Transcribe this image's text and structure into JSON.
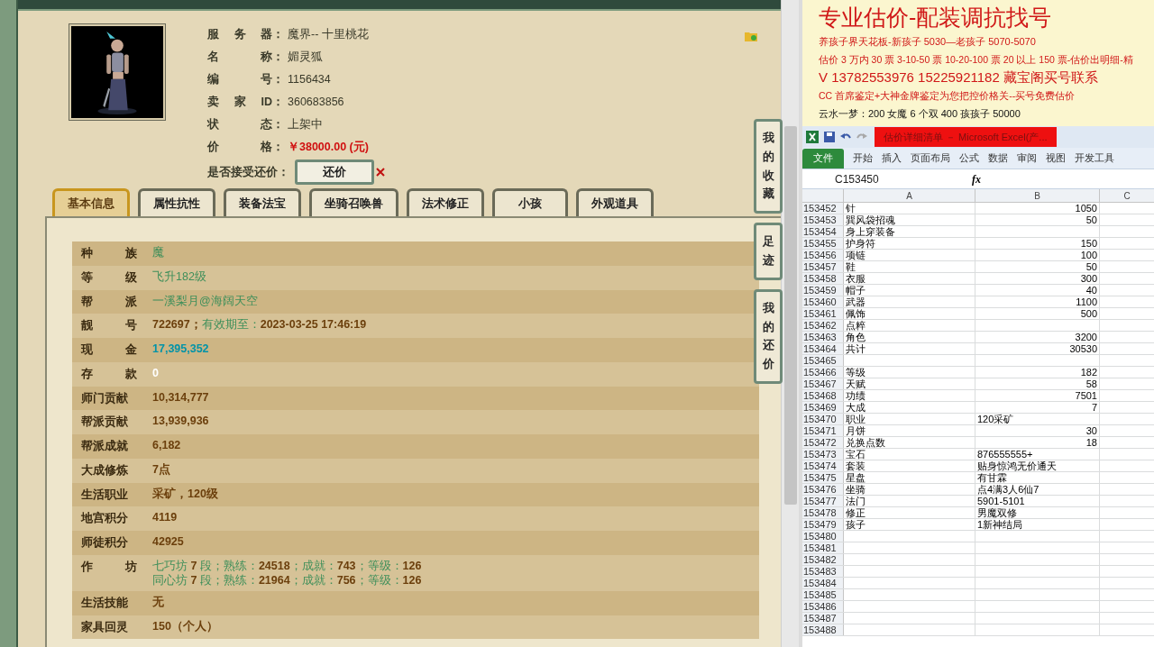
{
  "profile": {
    "info": [
      {
        "label": "服务器",
        "colon": "：",
        "value": "魔界-- 十里桃花",
        "kind": "plain"
      },
      {
        "label": "名称",
        "colon": "：",
        "value": "媚灵狐",
        "kind": "plain"
      },
      {
        "label": "编号",
        "colon": "：",
        "value": "1156434",
        "kind": "plain"
      },
      {
        "label": "卖家ID",
        "colon": "：",
        "value": "360683856",
        "kind": "plain"
      },
      {
        "label": "状态",
        "colon": "：",
        "value": "上架中",
        "kind": "plain"
      },
      {
        "label": "价格",
        "colon": "：",
        "value": "￥38000.00 (元)",
        "kind": "price"
      }
    ],
    "offer_label": "是否接受还价：",
    "offer_button": "还价"
  },
  "tabs": [
    {
      "label": "基本信息",
      "selected": true
    },
    {
      "label": "属性抗性",
      "selected": false
    },
    {
      "label": "装备法宝",
      "selected": false
    },
    {
      "label": "坐骑召唤兽",
      "selected": false
    },
    {
      "label": "法术修正",
      "selected": false
    },
    {
      "label": "小孩",
      "selected": false
    },
    {
      "label": "外观道具",
      "selected": false
    }
  ],
  "side_buttons": [
    "我的收藏",
    "足迹",
    "我的还价"
  ],
  "details": [
    {
      "label": "种族",
      "lines": [
        [
          {
            "text": "魔",
            "kind": "green"
          }
        ]
      ]
    },
    {
      "label": "等级",
      "lines": [
        [
          {
            "text": "飞升182级",
            "kind": "green"
          }
        ]
      ]
    },
    {
      "label": "帮派",
      "lines": [
        [
          {
            "text": "一溪梨月@海阔天空",
            "kind": "green"
          }
        ]
      ]
    },
    {
      "label": "靓号",
      "lines": [
        [
          {
            "text": "722697；",
            "kind": "number"
          },
          {
            "text": "有效期至：",
            "kind": "green"
          },
          {
            "text": "2023-03-25 17:46:19",
            "kind": "number"
          }
        ]
      ]
    },
    {
      "label": "现金",
      "lines": [
        [
          {
            "text": "17,395,352",
            "kind": "cyan"
          }
        ]
      ]
    },
    {
      "label": "存款",
      "lines": [
        [
          {
            "text": "0",
            "kind": "white"
          }
        ]
      ]
    },
    {
      "label": "师门贡献",
      "lines": [
        [
          {
            "text": "10,314,777",
            "kind": "number"
          }
        ]
      ]
    },
    {
      "label": "帮派贡献",
      "lines": [
        [
          {
            "text": "13,939,936",
            "kind": "number"
          }
        ]
      ]
    },
    {
      "label": "帮派成就",
      "lines": [
        [
          {
            "text": "6,182",
            "kind": "number"
          }
        ]
      ]
    },
    {
      "label": "大成修炼",
      "lines": [
        [
          {
            "text": "7点",
            "kind": "number"
          }
        ]
      ]
    },
    {
      "label": "生活职业",
      "lines": [
        [
          {
            "text": "采矿，120级",
            "kind": "number"
          }
        ]
      ]
    },
    {
      "label": "地宫积分",
      "lines": [
        [
          {
            "text": "4119",
            "kind": "number"
          }
        ]
      ]
    },
    {
      "label": "师徒积分",
      "lines": [
        [
          {
            "text": "42925",
            "kind": "number"
          }
        ]
      ]
    },
    {
      "label": "作坊",
      "lines": [
        [
          {
            "text": "七巧坊 ",
            "kind": "green"
          },
          {
            "text": "7",
            "kind": "number"
          },
          {
            "text": " 段；熟练：",
            "kind": "green"
          },
          {
            "text": "24518",
            "kind": "number"
          },
          {
            "text": "；成就：",
            "kind": "green"
          },
          {
            "text": "743",
            "kind": "number"
          },
          {
            "text": "；等级：",
            "kind": "green"
          },
          {
            "text": "126",
            "kind": "number"
          }
        ],
        [
          {
            "text": "同心坊 ",
            "kind": "green"
          },
          {
            "text": "7",
            "kind": "number"
          },
          {
            "text": " 段；熟练：",
            "kind": "green"
          },
          {
            "text": "21964",
            "kind": "number"
          },
          {
            "text": "；成就：",
            "kind": "green"
          },
          {
            "text": "756",
            "kind": "number"
          },
          {
            "text": "；等级：",
            "kind": "green"
          },
          {
            "text": "126",
            "kind": "number"
          }
        ]
      ]
    },
    {
      "label": "生活技能",
      "lines": [
        [
          {
            "text": "无",
            "kind": "number"
          }
        ]
      ]
    },
    {
      "label": "家具回灵",
      "lines": [
        [
          {
            "text": "150（个人）",
            "kind": "number"
          }
        ]
      ]
    }
  ],
  "notes": {
    "title": "专业估价-配装调抗找号",
    "lines": [
      {
        "text": "养孩子界天花板-新孩子 5030—老孩子 5070-5070",
        "kind": "red_small"
      },
      {
        "text": "估价 3 万内 30 票 3-10-50 票 10-20-100 票 20 以上 150 票-估价出明细-精",
        "kind": "red"
      },
      {
        "text": "V 13782553976    15225921182  藏宝阁买号联系",
        "kind": "red_large"
      },
      {
        "text": "CC 首席鉴定+大神金牌鉴定为您把控价格关--买号免费估价",
        "kind": "red"
      },
      {
        "text": "云水一梦：200 女魔 6 个双 400 孩孩子 50000",
        "kind": "black"
      }
    ]
  },
  "excel": {
    "title": "估价详细清单 － Microsoft Excel(产...",
    "file_tab": "文件",
    "ribbon_tabs": [
      "开始",
      "插入",
      "页面布局",
      "公式",
      "数据",
      "审阅",
      "视图",
      "开发工具"
    ],
    "name_box": "C153450",
    "formula_label": "fx",
    "columns": [
      "A",
      "B",
      "C"
    ],
    "rows": [
      {
        "num": "153452",
        "a": "针",
        "b": "1050",
        "kind": "number"
      },
      {
        "num": "153453",
        "a": "巽风袋招魂",
        "b": "50",
        "kind": "number"
      },
      {
        "num": "153454",
        "a": "身上穿装备",
        "kind": "number"
      },
      {
        "num": "153455",
        "a": "护身符",
        "b": "150",
        "kind": "number"
      },
      {
        "num": "153456",
        "a": "项链",
        "b": "100",
        "kind": "number"
      },
      {
        "num": "153457",
        "a": "鞋",
        "b": "50",
        "kind": "number"
      },
      {
        "num": "153458",
        "a": "衣服",
        "b": "300",
        "kind": "number"
      },
      {
        "num": "153459",
        "a": "帽子",
        "b": "40",
        "kind": "number"
      },
      {
        "num": "153460",
        "a": "武器",
        "b": "1100",
        "kind": "number"
      },
      {
        "num": "153461",
        "a": "佩饰",
        "b": "500",
        "kind": "number"
      },
      {
        "num": "153462",
        "a": "点粹",
        "kind": "number"
      },
      {
        "num": "153463",
        "a": "角色",
        "b": "3200",
        "kind": "number"
      },
      {
        "num": "153464",
        "a": "共计",
        "b": "30530",
        "kind": "number"
      },
      {
        "num": "153465",
        "kind": "number"
      },
      {
        "num": "153466",
        "a": "等级",
        "b": "182",
        "kind": "number"
      },
      {
        "num": "153467",
        "a": "天赋",
        "b": "58",
        "kind": "number"
      },
      {
        "num": "153468",
        "a": "功绩",
        "b": "7501",
        "kind": "number"
      },
      {
        "num": "153469",
        "a": "大成",
        "b": "7",
        "kind": "number"
      },
      {
        "num": "153470",
        "a": "职业",
        "b": "120采矿",
        "kind": "text"
      },
      {
        "num": "153471",
        "a": "月饼",
        "b": "30",
        "kind": "number"
      },
      {
        "num": "153472",
        "a": "兑换点数",
        "b": "18",
        "kind": "number"
      },
      {
        "num": "153473",
        "a": "宝石",
        "b": "876555555+",
        "kind": "text"
      },
      {
        "num": "153474",
        "a": "套装",
        "b": "贴身惊鸿无价通天",
        "kind": "text"
      },
      {
        "num": "153475",
        "a": "星盘",
        "b": "有甘霖",
        "kind": "text"
      },
      {
        "num": "153476",
        "a": "坐骑",
        "b": "点4满3人6仙7",
        "kind": "text"
      },
      {
        "num": "153477",
        "a": "法门",
        "b": "5901-5101",
        "kind": "text"
      },
      {
        "num": "153478",
        "a": "修正",
        "b": "男魔双修",
        "kind": "text"
      },
      {
        "num": "153479",
        "a": "孩子",
        "b": "1新神结局",
        "kind": "text"
      },
      {
        "num": "153480",
        "kind": "number"
      },
      {
        "num": "153481",
        "kind": "number"
      },
      {
        "num": "153482",
        "kind": "number"
      },
      {
        "num": "153483",
        "kind": "number"
      },
      {
        "num": "153484",
        "kind": "number"
      },
      {
        "num": "153485",
        "kind": "number"
      },
      {
        "num": "153486",
        "kind": "number"
      },
      {
        "num": "153487",
        "kind": "number"
      },
      {
        "num": "153488",
        "kind": "number"
      }
    ]
  }
}
